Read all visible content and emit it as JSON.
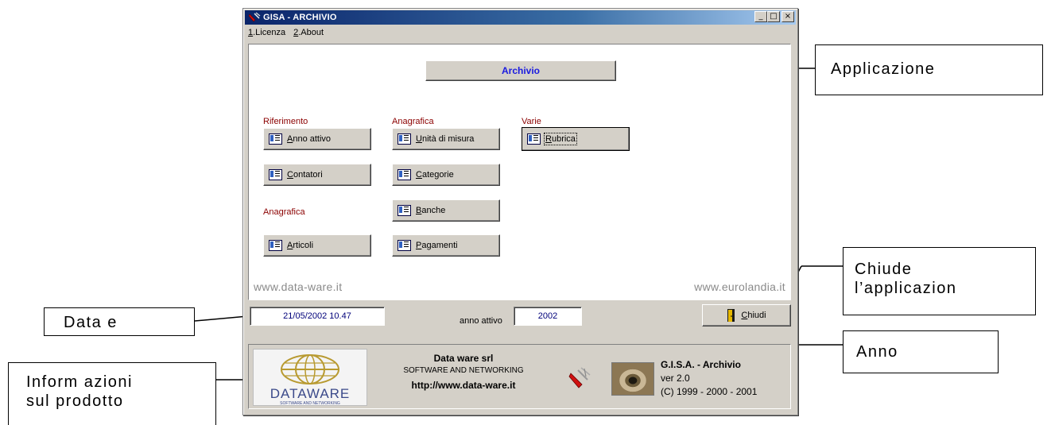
{
  "window": {
    "title": "GISA - ARCHIVIO",
    "controls": {
      "minimize": "_",
      "maximize": "□",
      "close": "×"
    }
  },
  "menu": {
    "items": [
      {
        "key": "1",
        "label": ".Licenza"
      },
      {
        "key": "2",
        "label": ".About"
      }
    ]
  },
  "main": {
    "archivio_button": "Archivio",
    "sections": {
      "riferimento": "Riferimento",
      "anagrafica_1": "Anagrafica",
      "varie": "Varie",
      "anagrafica_2": "Anagrafica"
    },
    "buttons": {
      "anno_attivo": {
        "hotkey": "A",
        "rest": "nno attivo"
      },
      "contatori": {
        "hotkey": "C",
        "rest": "ontatori"
      },
      "articoli": {
        "hotkey": "A",
        "rest": "rticoli"
      },
      "unita_misura": {
        "hotkey": "U",
        "rest": "nità di misura"
      },
      "categorie": {
        "hotkey": "C",
        "rest": "ategorie"
      },
      "banche": {
        "hotkey": "B",
        "rest": "anche"
      },
      "pagamenti": {
        "hotkey": "P",
        "rest": "agamenti"
      },
      "rubrica": {
        "hotkey": "R",
        "rest": "ubrica"
      }
    },
    "watermark_left": "www.data-ware.it",
    "watermark_right": "www.eurolandia.it"
  },
  "status": {
    "datetime": "21/05/2002  10.47",
    "anno_label": "anno attivo",
    "anno_value": "2002",
    "chiudi": {
      "hotkey": "C",
      "rest": "hiudi"
    }
  },
  "info": {
    "logo_text": "DATAWARE",
    "logo_sub": "SOFTWARE AND NETWORKING",
    "company_name": "Data ware srl",
    "company_tagline": "SOFTWARE AND NETWORKING",
    "company_url": "http://www.data-ware.it",
    "product_name": "G.I.S.A. - Archivio",
    "product_version": "ver 2.0",
    "product_copyright": "(C) 1999 - 2000 - 2001"
  },
  "callouts": {
    "applicazione": "Applicazione",
    "chiude_1": "Chiude",
    "chiude_2": "l’applicazion",
    "data": "Data e",
    "anno": "Anno",
    "informazioni_1": "Inform azioni",
    "informazioni_2": "sul prodotto"
  },
  "colors": {
    "title_gradient_start": "#0a246a",
    "section_label": "#8b0000",
    "archivio_text": "#1a1ae0",
    "window_face": "#d4d0c8"
  }
}
